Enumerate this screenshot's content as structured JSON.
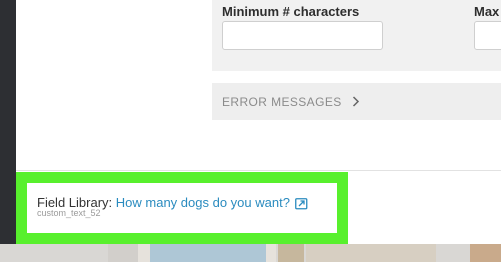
{
  "length_settings": {
    "min_label": "Minimum # characters",
    "min_value": "",
    "max_label": "Max",
    "max_value": ""
  },
  "error_messages": {
    "label": "ERROR MESSAGES",
    "chevron_icon": "chevron-right-icon"
  },
  "field_library": {
    "prefix": "Field Library:",
    "link_text": "How many dogs do you want?",
    "field_id": "custom_text_52",
    "link_icon": "open-in-window-icon"
  },
  "colors": {
    "highlight": "#58f02d",
    "link": "#2a8bbf",
    "card": "#f1f1f1"
  }
}
